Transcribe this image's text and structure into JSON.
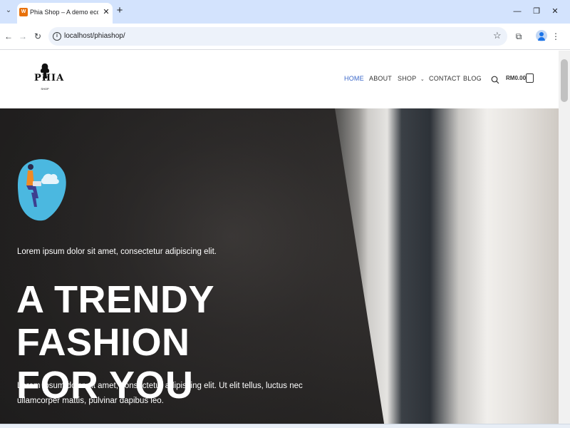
{
  "browser": {
    "tab": {
      "title": "Phia Shop – A demo ecommerce",
      "favicon_icon": "woocommerce-icon"
    },
    "controls": {
      "tab_menu": "⌄",
      "new_tab": "+",
      "close": "✕",
      "minimize": "—",
      "restore": "❐",
      "window_close": "✕"
    },
    "toolbar": {
      "url": "localhost/phiashop/",
      "back": "←",
      "forward": "→",
      "reload": "↻",
      "bookmark": "☆",
      "extensions": "⧉",
      "menu": "⋮"
    }
  },
  "site": {
    "logo": {
      "text": "PHIA",
      "subtext": "SHOP"
    },
    "nav": [
      {
        "label": "HOME",
        "active": true
      },
      {
        "label": "ABOUT",
        "active": false
      },
      {
        "label": "SHOP",
        "active": false,
        "has_dropdown": true
      },
      {
        "label": "CONTACT",
        "active": false
      },
      {
        "label": "BLOG",
        "active": false
      }
    ],
    "cart": {
      "total": "RM0.00"
    },
    "colors": {
      "accent": "#3a67c9",
      "hero_dark": "#2a2828",
      "blob": "#4bb8e0"
    }
  },
  "hero": {
    "kicker": "Lorem ipsum dolor sit amet, consectetur adipiscing elit.",
    "title_line1": "A TRENDY FASHION",
    "title_line2": "FOR YOU",
    "description": "Lorem ipsum dolor sit amet, consectetur adipiscing elit. Ut elit tellus, luctus nec ullamcorper mattis, pulvinar dapibus leo."
  }
}
